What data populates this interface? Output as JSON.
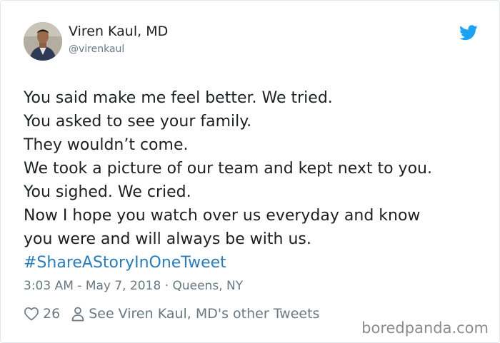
{
  "author": {
    "name": "Viren Kaul, MD",
    "handle": "@virenkaul"
  },
  "tweet": {
    "lines": [
      "You said make me feel better. We tried.",
      "You asked to see your family.",
      "They wouldn’t come.",
      "We took a picture of our team and kept next to you.",
      "You sighed. We cried.",
      "Now I hope you watch over us everyday and know",
      "you were and will always be with us."
    ],
    "hashtag": "#ShareAStoryInOneTweet"
  },
  "meta": {
    "timestamp": "3:03 AM - May 7, 2018",
    "separator": "·",
    "location": "Queens, NY"
  },
  "actions": {
    "like_count": "26",
    "other_tweets_label": "See Viren Kaul, MD's other Tweets"
  },
  "watermark": "boredpanda.com",
  "icons": {
    "brand": "twitter-bird-icon",
    "like": "heart-icon",
    "profile": "person-icon"
  },
  "colors": {
    "twitter_blue": "#1da1f2",
    "hashtag": "#2b7bb9",
    "text": "#1c2022",
    "muted": "#697882"
  }
}
